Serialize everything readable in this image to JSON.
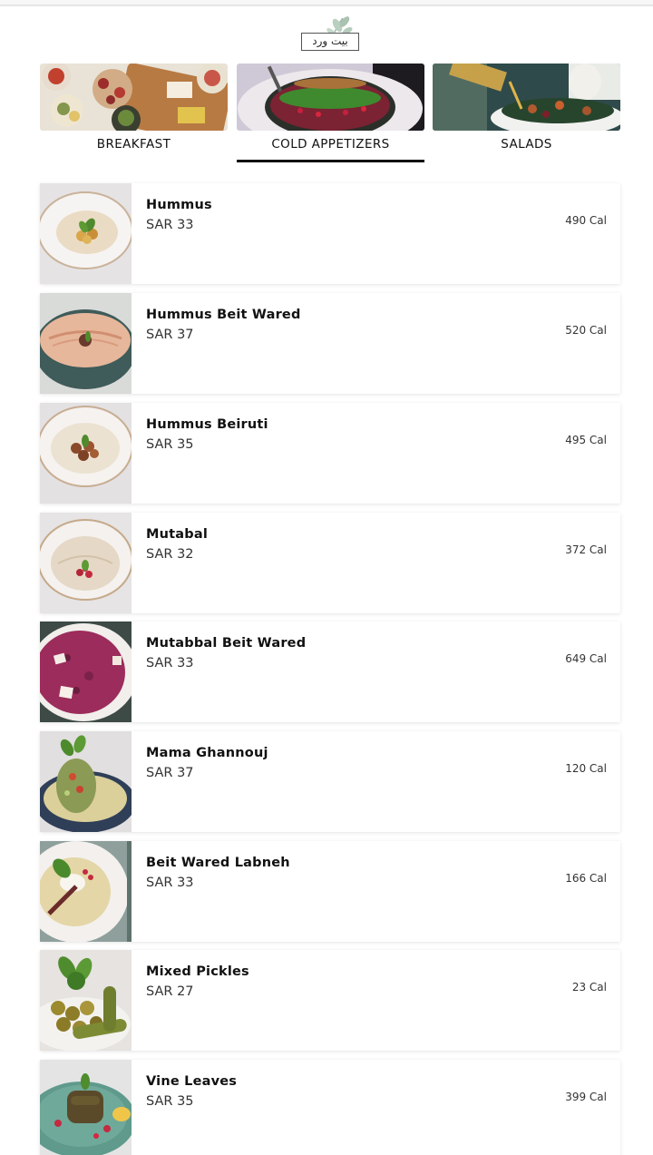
{
  "brand": {
    "logo_text": "بيت ورد"
  },
  "categories": [
    {
      "label": "BREAKFAST",
      "active": false
    },
    {
      "label": "COLD APPETIZERS",
      "active": true
    },
    {
      "label": "SALADS",
      "active": false
    }
  ],
  "items": [
    {
      "name": "Hummus",
      "price": "SAR 33",
      "calories": "490 Cal"
    },
    {
      "name": "Hummus Beit Wared",
      "price": "SAR 37",
      "calories": "520 Cal"
    },
    {
      "name": "Hummus Beiruti",
      "price": "SAR 35",
      "calories": "495 Cal"
    },
    {
      "name": "Mutabal",
      "price": "SAR 32",
      "calories": "372 Cal"
    },
    {
      "name": "Mutabbal Beit Wared",
      "price": "SAR 33",
      "calories": "649 Cal"
    },
    {
      "name": "Mama Ghannouj",
      "price": "SAR 37",
      "calories": "120 Cal"
    },
    {
      "name": "Beit Wared Labneh",
      "price": "SAR 33",
      "calories": "166 Cal"
    },
    {
      "name": "Mixed Pickles",
      "price": "SAR 27",
      "calories": "23 Cal"
    },
    {
      "name": "Vine Leaves",
      "price": "SAR 35",
      "calories": "399 Cal"
    }
  ]
}
